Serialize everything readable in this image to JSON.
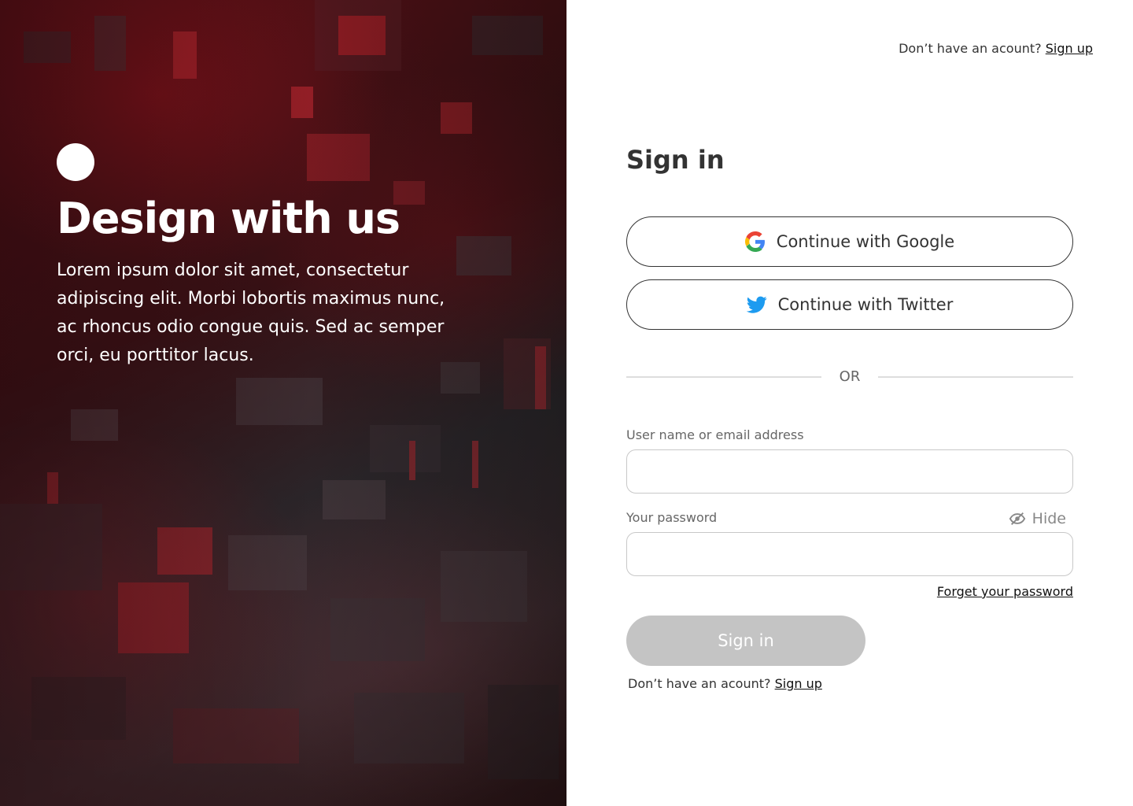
{
  "hero": {
    "title": "Design with us",
    "body": "Lorem ipsum dolor sit amet, consectetur adipiscing elit. Morbi lobortis maximus nunc, ac rhoncus odio congue quis. Sed ac semper orci, eu porttitor lacus."
  },
  "header": {
    "prompt": "Don’t have an acount?",
    "signup_link": "Sign up"
  },
  "form": {
    "title": "Sign in",
    "google_label": "Continue with Google",
    "twitter_label": "Continue with Twitter",
    "divider_label": "OR",
    "username_label": "User name or email address",
    "username_value": "",
    "password_label": "Your password",
    "password_value": "",
    "hide_label": "Hide",
    "forgot_label": "Forget your password",
    "submit_label": "Sign in",
    "footer_prompt": "Don’t have an acount?",
    "footer_signup_link": "Sign up"
  },
  "icons": {
    "google": "google-icon",
    "twitter": "twitter-icon",
    "hide": "eye-slash-icon"
  },
  "colors": {
    "accent_red": "#c4141e",
    "twitter_blue": "#1d9bf0",
    "submit_disabled": "#c4c4c4",
    "text_dark": "#333333",
    "text_muted": "#666666"
  }
}
